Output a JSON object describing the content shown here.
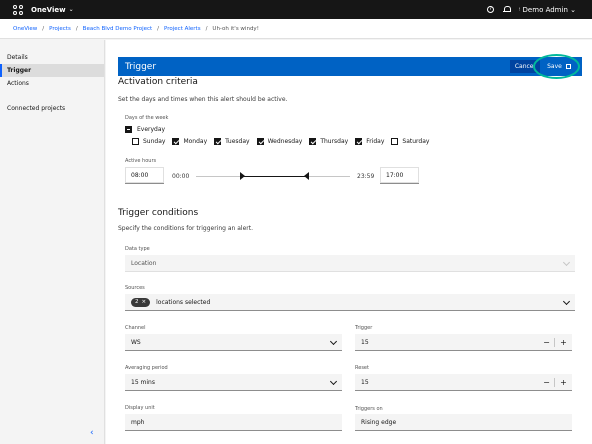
{
  "header": {
    "app_name": "OneView",
    "user": "Demo Admin"
  },
  "breadcrumb": [
    "OneView",
    "Projects",
    "Beach Blvd Demo Project",
    "Project Alerts",
    "Uh-oh it's windy!"
  ],
  "sidebar": {
    "items": [
      {
        "label": "Details"
      },
      {
        "label": "Trigger"
      },
      {
        "label": "Actions"
      },
      {
        "label": "Connected projects"
      }
    ]
  },
  "trigger": {
    "title": "Trigger",
    "cancel_label": "Cancel",
    "save_label": "Save"
  },
  "activation": {
    "heading": "Activation criteria",
    "description": "Set the days and times when this alert should be active.",
    "days_label": "Days of the week",
    "everyday_label": "Everyday",
    "days": [
      {
        "name": "Sunday",
        "checked": false
      },
      {
        "name": "Monday",
        "checked": true
      },
      {
        "name": "Tuesday",
        "checked": true
      },
      {
        "name": "Wednesday",
        "checked": true
      },
      {
        "name": "Thursday",
        "checked": true
      },
      {
        "name": "Friday",
        "checked": true
      },
      {
        "name": "Saturday",
        "checked": false
      }
    ],
    "hours_label": "Active hours",
    "start": "08:00",
    "min": "00:00",
    "max": "23:59",
    "end": "17:00"
  },
  "conditions": {
    "heading": "Trigger conditions",
    "description": "Specify the conditions for triggering an alert.",
    "data_type_label": "Data type",
    "data_type_value": "Location",
    "sources_label": "Sources",
    "sources_count": "2",
    "sources_text": "locations selected",
    "channel_label": "Channel",
    "channel_value": "WS",
    "trigger_label": "Trigger",
    "trigger_value": "15",
    "averaging_label": "Averaging period",
    "averaging_value": "15 mins",
    "reset_label": "Reset",
    "reset_value": "15",
    "display_unit_label": "Display unit",
    "display_unit_value": "mph",
    "triggers_on_label": "Triggers on",
    "triggers_on_value": "Rising edge"
  }
}
